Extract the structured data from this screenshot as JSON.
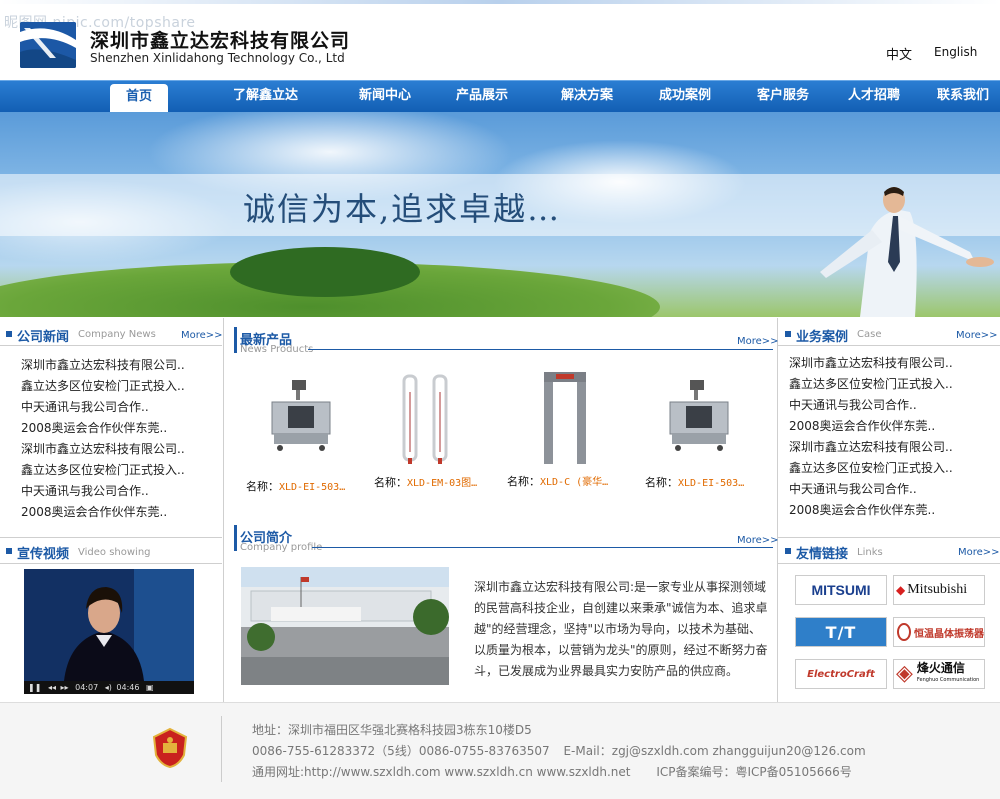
{
  "header": {
    "watermark": "昵图网 nipic.com/topshare",
    "company_cn": "深圳市鑫立达宏科技有限公司",
    "company_en": "Shenzhen Xinlidahong Technology Co., Ltd",
    "lang_cn": "中文",
    "lang_en": "English"
  },
  "nav": {
    "home": "首页",
    "items": [
      "了解鑫立达",
      "新闻中心",
      "产品展示",
      "解决方案",
      "成功案例",
      "客户服务",
      "人才招聘",
      "联系我们"
    ]
  },
  "banner": {
    "slogan": "诚信为本,追求卓越…"
  },
  "news": {
    "title": "公司新闻",
    "subtitle": "Company News",
    "more": "More>>",
    "items": [
      "深圳市鑫立达宏科技有限公司..",
      "鑫立达多区位安检门正式投入..",
      "中天通讯与我公司合作..",
      "2008奥运会合作伙伴东莞..",
      "深圳市鑫立达宏科技有限公司..",
      "鑫立达多区位安检门正式投入..",
      "中天通讯与我公司合作..",
      "2008奥运会合作伙伴东莞.."
    ]
  },
  "video": {
    "title": "宣传视频",
    "subtitle": "Video showing",
    "time_current": "04:07",
    "time_total": "04:46"
  },
  "products": {
    "title": "最新产品",
    "subtitle": "News Products",
    "more": "More>>",
    "label": "名称：",
    "items": [
      "XLD-EI-503…",
      "XLD-EM-03图…",
      "XLD-C (豪华…",
      "XLD-EI-503…"
    ]
  },
  "profile": {
    "title": "公司简介",
    "subtitle": "Company profile",
    "more": "More>>",
    "lines": [
      "深圳市鑫立达宏科技有限公司:是一家专业从事探测领域",
      "的民营高科技企业，自创建以来秉承\"诚信为本、追求卓",
      "越\"的经营理念，坚持\"以市场为导向，以技术为基础、",
      "以质量为根本，以营销为龙头\"的原则，经过不断努力奋",
      "斗，已发展成为业界最具实力安防产品的供应商。"
    ]
  },
  "cases": {
    "title": "业务案例",
    "subtitle": "Case",
    "more": "More>>",
    "items": [
      "深圳市鑫立达宏科技有限公司..",
      "鑫立达多区位安检门正式投入..",
      "中天通讯与我公司合作..",
      "2008奥运会合作伙伴东莞..",
      "深圳市鑫立达宏科技有限公司..",
      "鑫立达多区位安检门正式投入..",
      "中天通讯与我公司合作..",
      "2008奥运会合作伙伴东莞.."
    ]
  },
  "links": {
    "title": "友情链接",
    "subtitle": "Links",
    "more": "More>>",
    "partners": [
      "MITSUMI",
      "Mitsubishi",
      "T/T",
      "恒温晶体振荡器",
      "ElectroCraft",
      "烽火通信"
    ],
    "fenghuo_en": "Fenghuo Communication"
  },
  "footer": {
    "address": "地址：深圳市福田区华强北赛格科技园3栋东10楼D5",
    "phone": "0086-755-61283372（5线）0086-0755-83763507",
    "email_label": "E-Mail：",
    "email": "zgj@szxldh.com zhangguijun20@126.com",
    "web": "通用网址:http://www.szxldh.com www.szxldh.cn www.szxldh.net",
    "icp": "ICP备案编号：粤ICP备05105666号"
  },
  "colors": {
    "nav_blue": "#1a6cc4",
    "section_blue": "#1d5aa6",
    "product_name_orange": "#e06a00"
  }
}
